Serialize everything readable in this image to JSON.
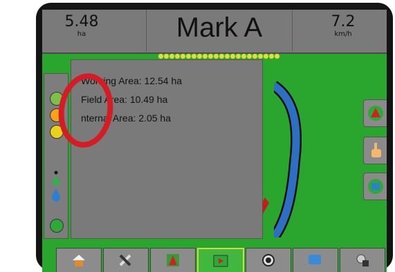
{
  "header": {
    "left_value": "5.48",
    "left_unit": "ha",
    "title": "Mark A",
    "right_value": "7.2",
    "right_unit": "km/h"
  },
  "area_panel": {
    "working_area": "Working Area: 12.54 ha",
    "field_area": "Field Area: 10.49 ha",
    "internal_area": "nternal Area: 2.05 ha"
  },
  "colors": {
    "field_green": "#2aa52e",
    "panel_gray": "#7a7a7a",
    "annotation_red": "#d41c25",
    "active_tab": "#41b83d"
  },
  "sidebar_icons": [
    "field-area-icon",
    "boundary-warning-icon",
    "coverage-warning-icon",
    "gps-antenna-icon",
    "water-drop-icon",
    "link-icon"
  ],
  "right_buttons": [
    "guidance-arrow-icon",
    "hand-touch-icon",
    "map-view-icon"
  ],
  "bottom_tabs": [
    "home-icon",
    "tools-icon",
    "guidance-icon",
    "field-map-icon",
    "camera-icon",
    "display-icon",
    "lock-settings-icon"
  ]
}
